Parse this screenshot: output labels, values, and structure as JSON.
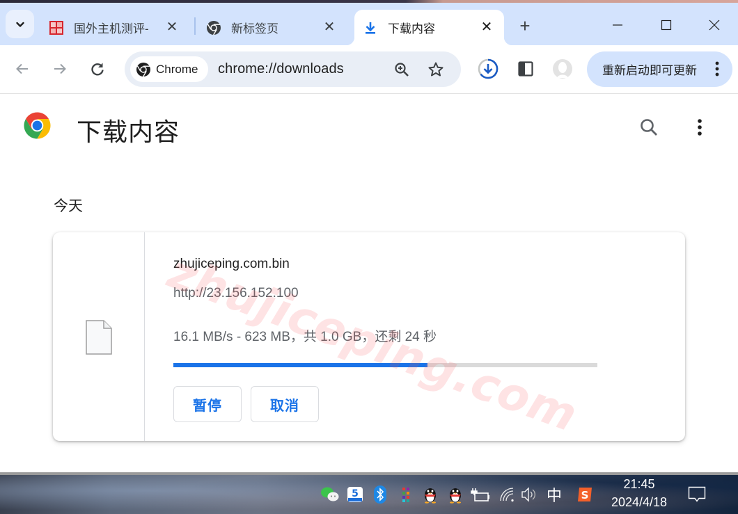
{
  "browser": {
    "tabs": [
      {
        "title": "国外主机测评-",
        "favicon": "seal-favicon",
        "active": false
      },
      {
        "title": "新标签页",
        "favicon": "chrome-icon",
        "active": false
      },
      {
        "title": "下载内容",
        "favicon": "download-icon",
        "active": true
      }
    ],
    "tab_close_glyph": "✕",
    "new_tab_glyph": "+",
    "window_controls": {
      "minimize": "—",
      "maximize": "☐",
      "close": "✕"
    },
    "omnibox": {
      "chip_label": "Chrome",
      "url": "chrome://downloads"
    },
    "update_button_label": "重新启动即可更新",
    "accent_color": "#1a73e8",
    "tabstrip_color": "#d3e3fd"
  },
  "page": {
    "title": "下载内容",
    "section_date": "今天",
    "download": {
      "file_name": "zhujiceping.com.bin",
      "source_url": "http://23.156.152.100",
      "status": "16.1 MB/s - 623 MB，共 1.0 GB，还剩 24 秒",
      "progress_percent": 60,
      "pause_label": "暂停",
      "cancel_label": "取消"
    },
    "watermark": "zhujiceping.com"
  },
  "taskbar": {
    "tray_icons": [
      "wechat-icon",
      "app-5-icon",
      "bluetooth-icon",
      "color-grid-icon",
      "qq-icon",
      "qq-icon",
      "battery-charging-icon",
      "wifi-icon",
      "volume-icon"
    ],
    "ime_label": "中",
    "sogou_label": "S",
    "time": "21:45",
    "date": "2024/4/18"
  }
}
